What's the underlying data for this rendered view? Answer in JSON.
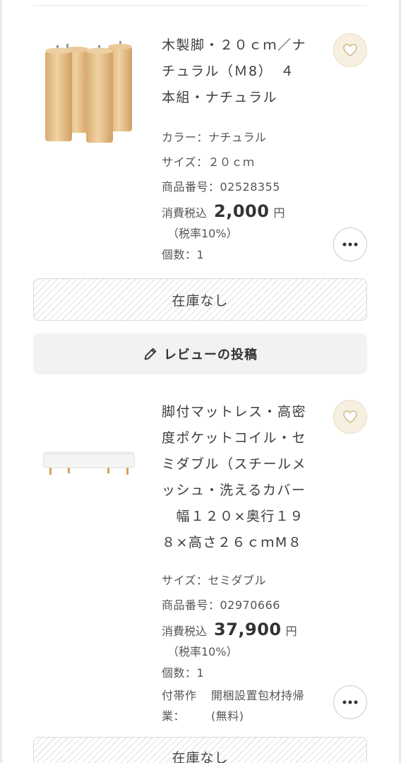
{
  "products": [
    {
      "title": "木製脚・２０ｃｍ／ナチュラル（Ｍ8）　４本組・ナチュラル",
      "title_lines": [
        "木製脚・２０ｃｍ／ナ",
        "チュラル（Ｍ8）　４",
        "本組・ナチュラル"
      ],
      "color": "カラー：ナチュラル",
      "size": "サイズ：２０ｃｍ",
      "product_no": "商品番号：02528355",
      "price_label": "消費税込",
      "price": "2,000",
      "currency": "円",
      "tax_note": "（税率10%）",
      "quantity": "個数：1",
      "stock_status": "在庫なし"
    },
    {
      "title": "脚付マットレス・高密度ポケットコイル・セミダブル（スチールメッシュ・洗えるカバー　幅１２０×奥行１９８×高さ２６ｃｍM8",
      "title_lines": [
        "脚付マットレス・高密",
        "度ポケットコイル・セ",
        "ミダブル（スチールメ",
        "ッシュ・洗えるカバー",
        "　幅１２０×奥行１９",
        "８×高さ２６ｃｍM８"
      ],
      "size": "サイズ：セミダブル",
      "product_no": "商品番号：02970666",
      "price_label": "消費税込",
      "price": "37,900",
      "currency": "円",
      "tax_note": "（税率10%）",
      "quantity": "個数：1",
      "service_label": "付帯作業：",
      "service_label_line1": "付帯作",
      "service_label_line2": "業：",
      "service_value": "開梱設置包材持帰(無料)",
      "service_value_line1": "開梱設置包材持帰",
      "service_value_line2": "(無料)",
      "stock_status": "在庫なし"
    }
  ],
  "review_button": {
    "label": "レビューの投稿"
  },
  "icons": {
    "favorite": "heart-icon",
    "more": "ellipsis-icon",
    "review": "pencil-icon"
  },
  "colors": {
    "favorite_bg": "#f7efe0",
    "favorite_stroke": "#d8c39a",
    "text": "#3c3c3c"
  }
}
